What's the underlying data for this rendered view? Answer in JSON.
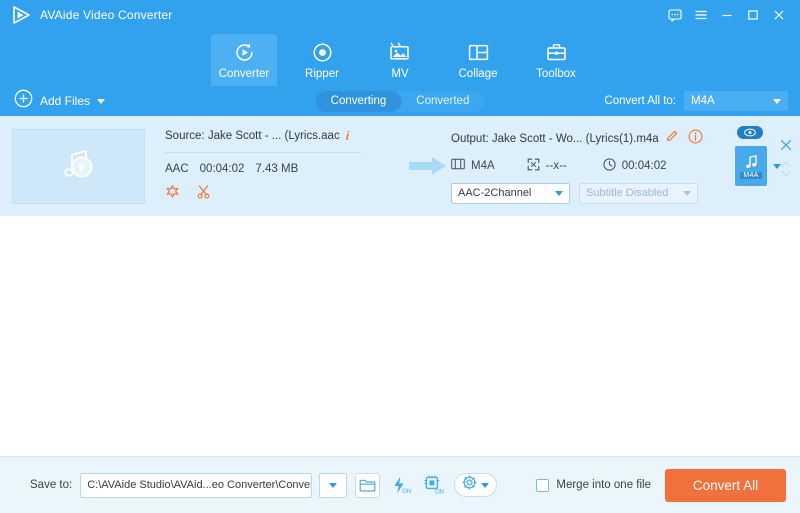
{
  "titlebar": {
    "app_title": "AVAide Video Converter",
    "logo_icon": "play-triangle-logo",
    "buttons": [
      {
        "name": "feedback-icon",
        "glyph": "chat"
      },
      {
        "name": "menu-icon",
        "glyph": "hamburger"
      },
      {
        "name": "minimize-icon",
        "glyph": "minimize"
      },
      {
        "name": "maximize-icon",
        "glyph": "maximize"
      },
      {
        "name": "close-icon",
        "glyph": "close"
      }
    ]
  },
  "nav": {
    "tabs": [
      {
        "label": "Converter",
        "icon": "converter-icon",
        "active": true
      },
      {
        "label": "Ripper",
        "icon": "ripper-disc-icon",
        "active": false
      },
      {
        "label": "MV",
        "icon": "mv-picture-icon",
        "active": false
      },
      {
        "label": "Collage",
        "icon": "collage-grid-icon",
        "active": false
      },
      {
        "label": "Toolbox",
        "icon": "toolbox-briefcase-icon",
        "active": false
      }
    ]
  },
  "toolbar": {
    "add_files_label": "Add Files",
    "segments": [
      {
        "label": "Converting",
        "active": true
      },
      {
        "label": "Converted",
        "active": false
      }
    ],
    "convert_all_to_label": "Convert All to:",
    "convert_all_to_value": "M4A"
  },
  "file_row": {
    "thumbnail_icon": "music-note-play-thumbnail",
    "source": {
      "label": "Source: Jake Scott - ... (Lyrics.aac",
      "info_icon": "info-icon",
      "format": "AAC",
      "duration": "00:04:02",
      "size": "7.43 MB",
      "actions": [
        {
          "name": "edit-wand-icon"
        },
        {
          "name": "cut-scissors-icon"
        }
      ]
    },
    "output": {
      "label": "Output: Jake Scott - Wo... (Lyrics(1).m4a",
      "edit_icon": "pencil-edit-icon",
      "info_icon": "info-circle-icon",
      "format": "M4A",
      "resolution": "--x--",
      "duration": "00:04:02",
      "audio_profile": "AAC-2Channel",
      "subtitle": "Subtitle Disabled",
      "file_badge": "M4A",
      "preview_badge_icon": "preview-eye-icon"
    },
    "row_controls": [
      {
        "name": "remove-file-icon"
      },
      {
        "name": "expand-collapse-icon"
      }
    ]
  },
  "bottombar": {
    "save_to_label": "Save to:",
    "save_to_path": "C:\\AVAide Studio\\AVAid...eo Converter\\Converted",
    "buttons": [
      {
        "name": "open-folder-icon"
      },
      {
        "name": "hardware-acceleration-icon",
        "state": "ON"
      },
      {
        "name": "gpu-acceleration-icon",
        "state": "ON"
      },
      {
        "name": "settings-gear-icon"
      }
    ],
    "merge_label": "Merge into one file",
    "merge_checked": false,
    "convert_all_label": "Convert All"
  },
  "colors": {
    "header_blue": "#32a2ef",
    "active_tab_blue": "#4cb0f3",
    "row_blue": "#dceffb",
    "accent_orange": "#f2703c",
    "bottom_bar": "#eaf5fc"
  }
}
